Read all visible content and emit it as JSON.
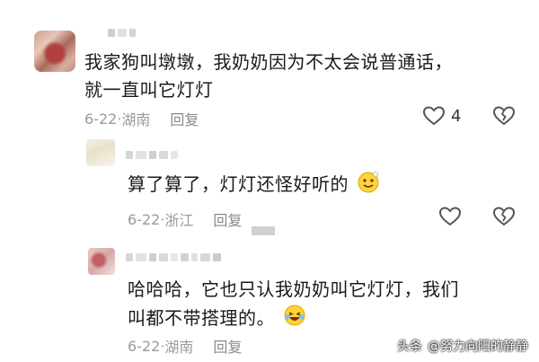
{
  "comments": [
    {
      "text_line1": "我家狗叫墩墩，我奶奶因为不太会说普通话，",
      "text_line2": "就一直叫它灯灯",
      "date": "6-22",
      "location": "湖南",
      "reply_label": "回复",
      "like_count": "4"
    },
    {
      "text": "算了算了，灯灯还怪好听的",
      "emoji": "smiling-face-emoji",
      "date": "6-22",
      "location": "浙江",
      "reply_label": "回复"
    },
    {
      "text_line1": "哈哈哈，它也只认我奶奶叫它灯灯，我们",
      "text_line2": "叫都不带搭理的。",
      "emoji": "laughing-face-emoji",
      "date": "6-22",
      "location": "湖南",
      "reply_label": "回复"
    }
  ],
  "watermark": {
    "platform": "头条",
    "author": "@努力向阳的静静"
  },
  "icons": [
    "heart-icon",
    "broken-heart-icon"
  ],
  "colors": {
    "meta_text": "#9a9a9a",
    "body_text": "#1a1a1a"
  }
}
